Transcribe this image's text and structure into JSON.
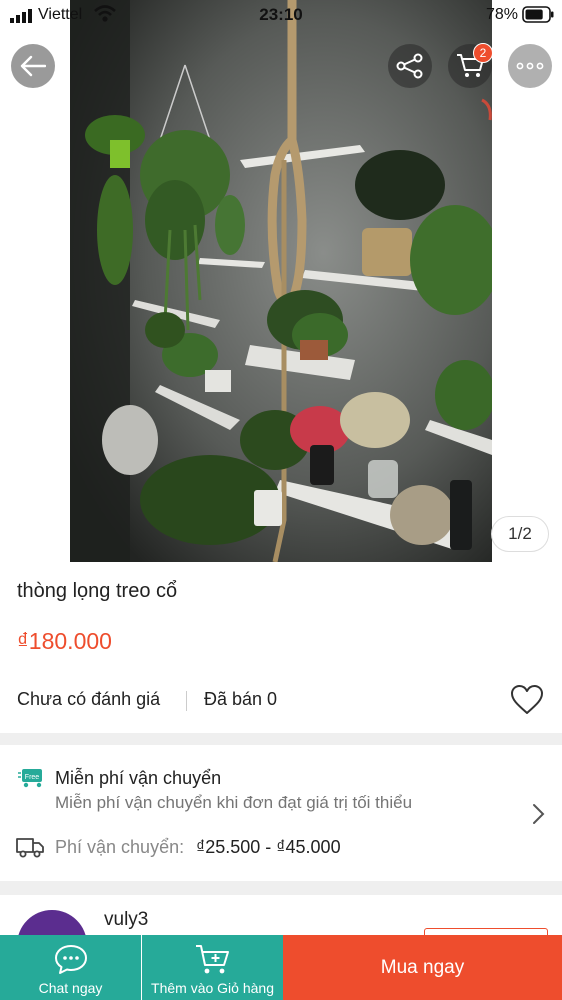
{
  "status_bar": {
    "carrier": "Viettel",
    "time": "23:10",
    "battery": "78%",
    "battery_level": 0.78
  },
  "header": {
    "cart_count": "2",
    "image_counter": "1/2"
  },
  "product": {
    "title": "thòng lọng treo cổ",
    "price": "₫180.000",
    "rating_text": "Chưa có đánh giá",
    "sold_text": "Đã bán 0"
  },
  "shipping": {
    "free_badge": "Free",
    "title": "Miễn phí vận chuyển",
    "subtitle": "Miễn phí vận chuyển khi đơn đạt giá trị tối thiểu",
    "fee_label": "Phí vận chuyển:",
    "fee_value": "₫25.500 - ₫45.000"
  },
  "shop": {
    "name": "vuly3"
  },
  "bottom_bar": {
    "chat_label": "Chat ngay",
    "add_cart_label": "Thêm vào Giỏ hàng",
    "buy_label": "Mua ngay"
  },
  "colors": {
    "accent": "#ee4d2d",
    "teal": "#26aa99"
  }
}
